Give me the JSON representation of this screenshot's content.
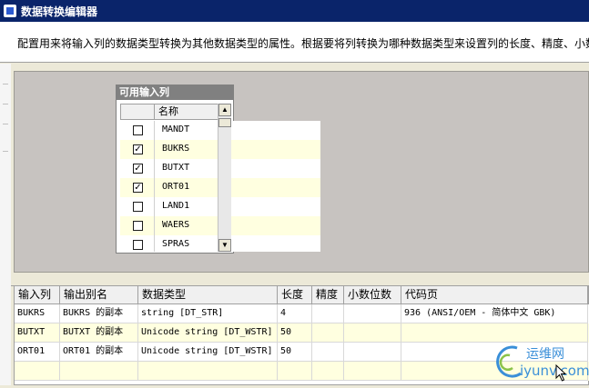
{
  "window": {
    "title": "数据转换编辑器",
    "description": "配置用来将输入列的数据类型转换为其他数据类型的属性。根据要将列转换为哪种数据类型来设置列的长度、精度、小数"
  },
  "available_columns": {
    "title": "可用输入列",
    "header_name": "名称",
    "items": [
      {
        "name": "MANDT",
        "checked": false,
        "mark": ""
      },
      {
        "name": "BUKRS",
        "checked": true,
        "mark": "✓"
      },
      {
        "name": "BUTXT",
        "checked": true,
        "mark": "✓"
      },
      {
        "name": "ORT01",
        "checked": true,
        "mark": "✓"
      },
      {
        "name": "LAND1",
        "checked": false,
        "mark": ""
      },
      {
        "name": "WAERS",
        "checked": false,
        "mark": ""
      },
      {
        "name": "SPRAS",
        "checked": false,
        "mark": ""
      }
    ]
  },
  "grid": {
    "headers": [
      "输入列",
      "输出别名",
      "数据类型",
      "长度",
      "精度",
      "小数位数",
      "代码页"
    ],
    "rows": [
      [
        "BUKRS",
        "BUKRS 的副本",
        "string [DT_STR]",
        "4",
        "",
        "",
        "936   (ANSI/OEM - 简体中文 GBK)"
      ],
      [
        "BUTXT",
        "BUTXT 的副本",
        "Unicode string [DT_WSTR]",
        "50",
        "",
        "",
        ""
      ],
      [
        "ORT01",
        "ORT01 的副本",
        "Unicode string [DT_WSTR]",
        "50",
        "",
        "",
        ""
      ]
    ]
  },
  "watermark": {
    "line1": "运维网",
    "line2": "iyunv.com"
  },
  "colors": {
    "titlebar": "#0a246a",
    "canvas": "#c7c3c0",
    "row_alt": "#ffffe0"
  }
}
